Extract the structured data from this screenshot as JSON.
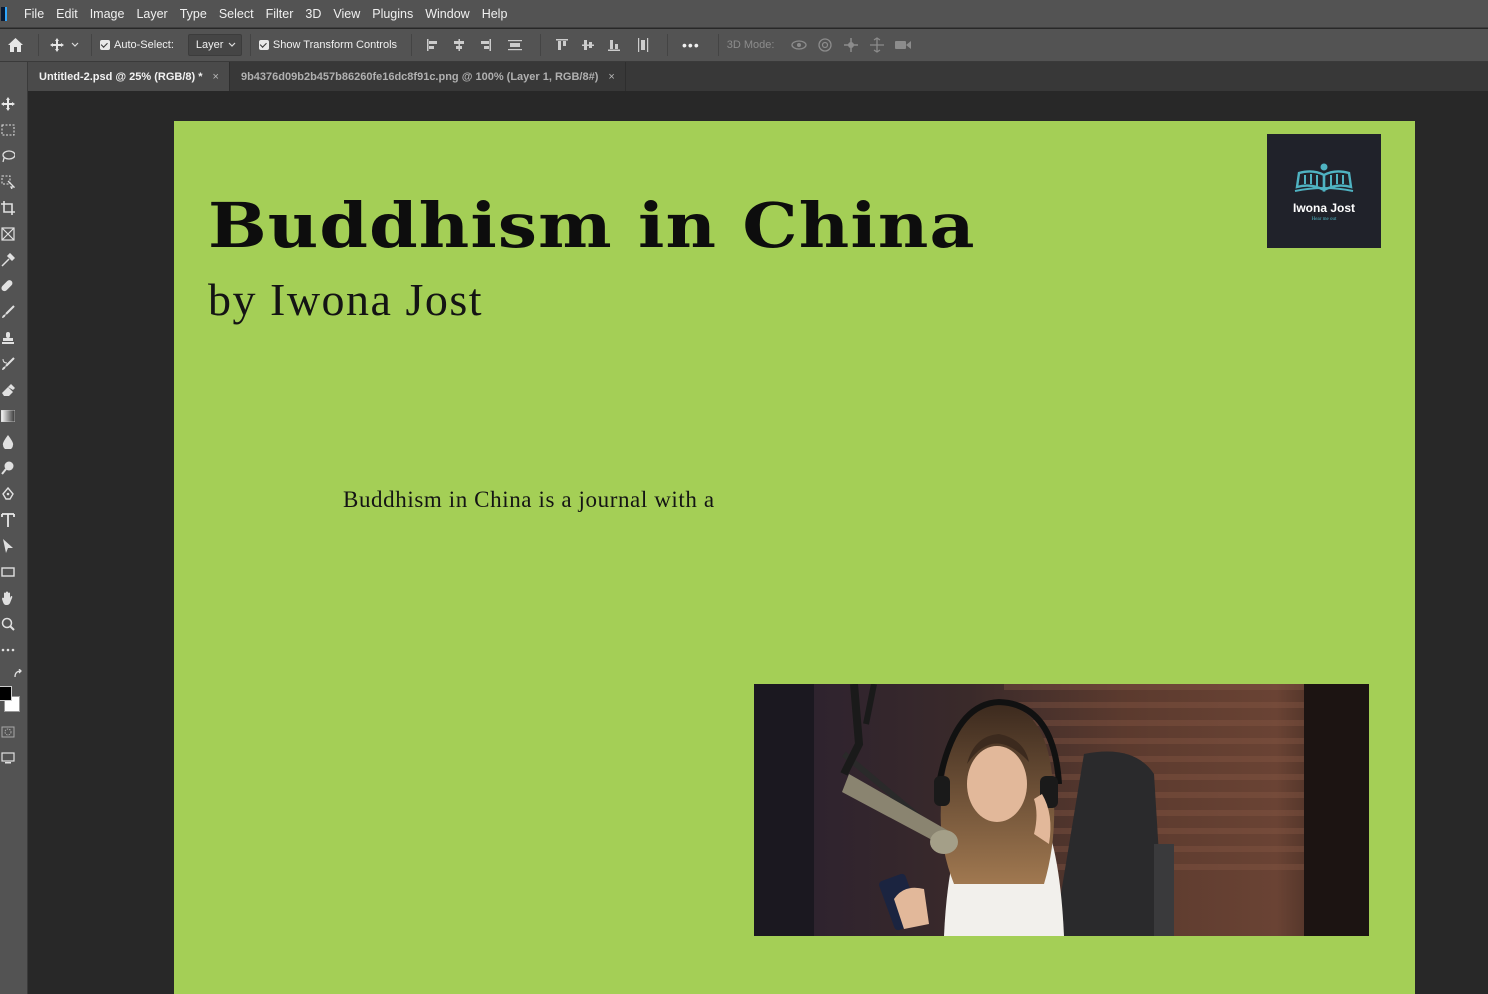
{
  "app": {
    "menu": [
      "File",
      "Edit",
      "Image",
      "Layer",
      "Type",
      "Select",
      "Filter",
      "3D",
      "View",
      "Plugins",
      "Window",
      "Help"
    ]
  },
  "options_bar": {
    "auto_select_label": "Auto-Select:",
    "auto_select_value": "Layer",
    "show_transform_label": "Show Transform Controls",
    "more_label": "•••",
    "mode_3d_label": "3D Mode:"
  },
  "tabs": [
    {
      "label": "Untitled-2.psd @ 25% (RGB/8) *",
      "close": "×",
      "active": true
    },
    {
      "label": "9b4376d09b2b457b86260fe16dc8f91c.png @ 100% (Layer 1, RGB/8#)",
      "close": "×",
      "active": false
    }
  ],
  "document": {
    "title": "Buddhism in China",
    "subtitle": "by Iwona Jost",
    "body": "Buddhism in China is a journal with a",
    "logo_name": "Iwona Jost",
    "logo_tagline": "Hear me out",
    "background_color": "#a4cf56",
    "photo_description_icon": "podcast-host-photo"
  },
  "colors": {
    "foreground": "#000000",
    "background": "#ffffff",
    "accent_logo": "#4fb3c2"
  }
}
